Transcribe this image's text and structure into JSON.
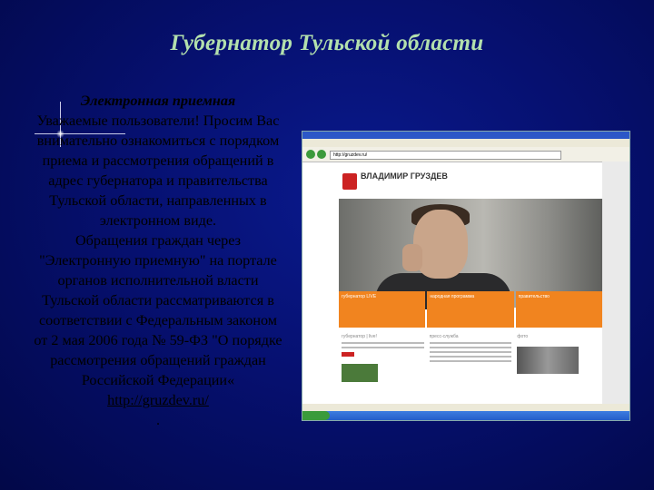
{
  "slide": {
    "title": "Губернатор Тульской области",
    "subtitle": "Электронная приемная",
    "para1": "Уважаемые пользователи! Просим Вас внимательно ознакомиться с порядком приема и рассмотрения обращений в адрес губернатора и правительства Тульской области, направленных в электронном виде.",
    "para2": "Обращения граждан через \"Электронную приемную\" на портале органов исполнительной власти Тульской области рассматриваются в соответствии с Федеральным законом от 2 мая 2006 года № 59-ФЗ \"О порядке рассмотрения обращений граждан Российской Федерации«",
    "link": "http://gruzdev.ru/",
    "dot": "."
  },
  "screenshot": {
    "site_name": "ВЛАДИМИР ГРУЗДЕВ",
    "address": "http://gruzdev.ru/",
    "orange_tabs": [
      "губернатор LIVE",
      "народная программа",
      "правительство"
    ],
    "lower_cols": [
      "губернатор | live!",
      "пресс-служба",
      "фото"
    ]
  },
  "colors": {
    "title": "#b3e0ad",
    "background": "#061070",
    "accent_orange": "#f1841f"
  }
}
